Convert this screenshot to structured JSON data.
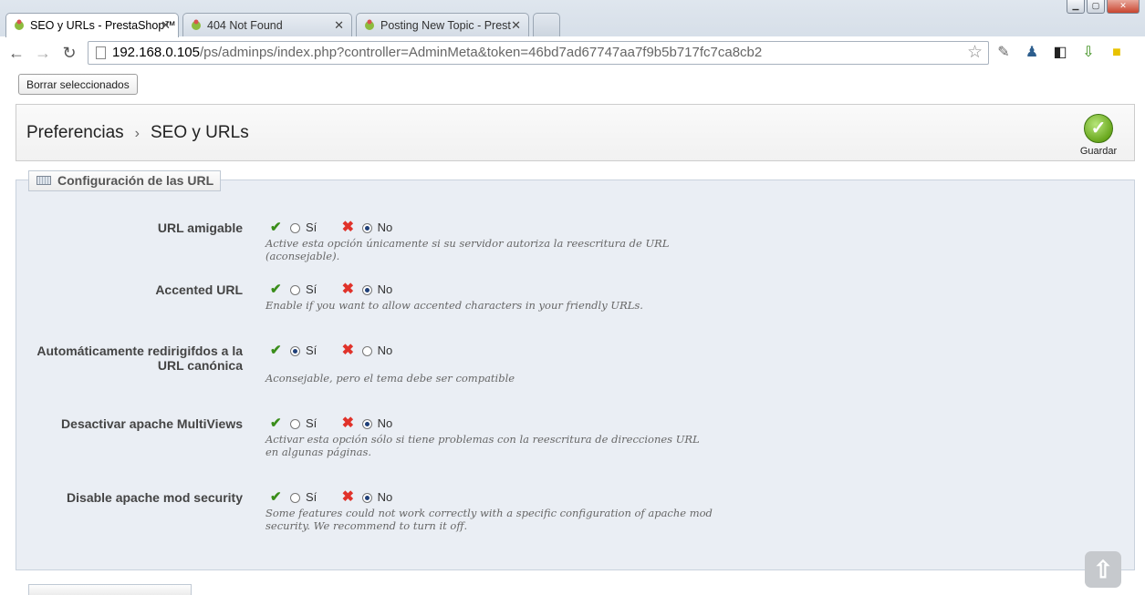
{
  "browser": {
    "tabs": [
      {
        "title": "SEO y URLs - PrestaShop™",
        "active": true
      },
      {
        "title": "404 Not Found",
        "active": false
      },
      {
        "title": "Posting New Topic - Prest",
        "active": false
      }
    ],
    "url_host": "192.168.0.105",
    "url_path": "/ps/adminps/index.php?controller=AdminMeta&token=46bd7ad67747aa7f9b5b717fc7ca8cb2"
  },
  "page": {
    "delete_selected": "Borrar seleccionados",
    "breadcrumb": [
      "Preferencias",
      "SEO y URLs"
    ],
    "save_label": "Guardar",
    "fieldset_legend": "Configuración de las URL",
    "yes_label": "Sí",
    "no_label": "No",
    "options": [
      {
        "label": "URL amigable",
        "value": "No",
        "hint": "Active esta opción únicamente si su servidor autoriza la reescritura de URL (aconsejable)."
      },
      {
        "label": "Accented URL",
        "value": "No",
        "hint": "Enable if you want to allow accented characters in your friendly URLs."
      },
      {
        "label": "Automáticamente redirigifdos a la URL canónica",
        "value": "Sí",
        "hint": "Aconsejable, pero el tema debe ser compatible"
      },
      {
        "label": "Desactivar apache MultiViews",
        "value": "No",
        "hint": "Activar esta opción sólo si tiene problemas con la reescritura de direcciones URL en algunas páginas."
      },
      {
        "label": "Disable apache mod security",
        "value": "No",
        "hint": "Some features could not work correctly with a specific configuration of apache mod security. We recommend to turn it off."
      }
    ]
  }
}
